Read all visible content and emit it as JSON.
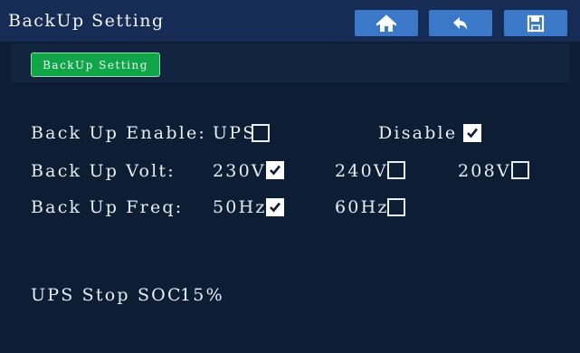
{
  "window": {
    "title": "BackUp Setting"
  },
  "toolbar": {
    "home_icon": "home-icon",
    "back_icon": "back-arrow-icon",
    "save_icon": "save-icon",
    "button_color": "#3b79c8"
  },
  "tabs": [
    {
      "label": "BackUp Setting",
      "active": true,
      "color": "#11a54a"
    }
  ],
  "settings": {
    "enable": {
      "label": "Back Up Enable:",
      "options": [
        {
          "label": "UPS",
          "checked": false
        },
        {
          "label": "Disable",
          "checked": true
        }
      ]
    },
    "volt": {
      "label": "Back Up Volt:",
      "options": [
        {
          "label": "230V",
          "checked": true
        },
        {
          "label": "240V",
          "checked": false
        },
        {
          "label": "208V",
          "checked": false
        }
      ]
    },
    "freq": {
      "label": "Back Up Freq:",
      "options": [
        {
          "label": "50Hz",
          "checked": true
        },
        {
          "label": "60Hz",
          "checked": false
        }
      ]
    }
  },
  "soc": {
    "label": "UPS Stop SOC:",
    "value": "15%"
  },
  "colors": {
    "background": "#0d1d33",
    "titlebar": "#162c54",
    "text": "#e8eef8"
  }
}
